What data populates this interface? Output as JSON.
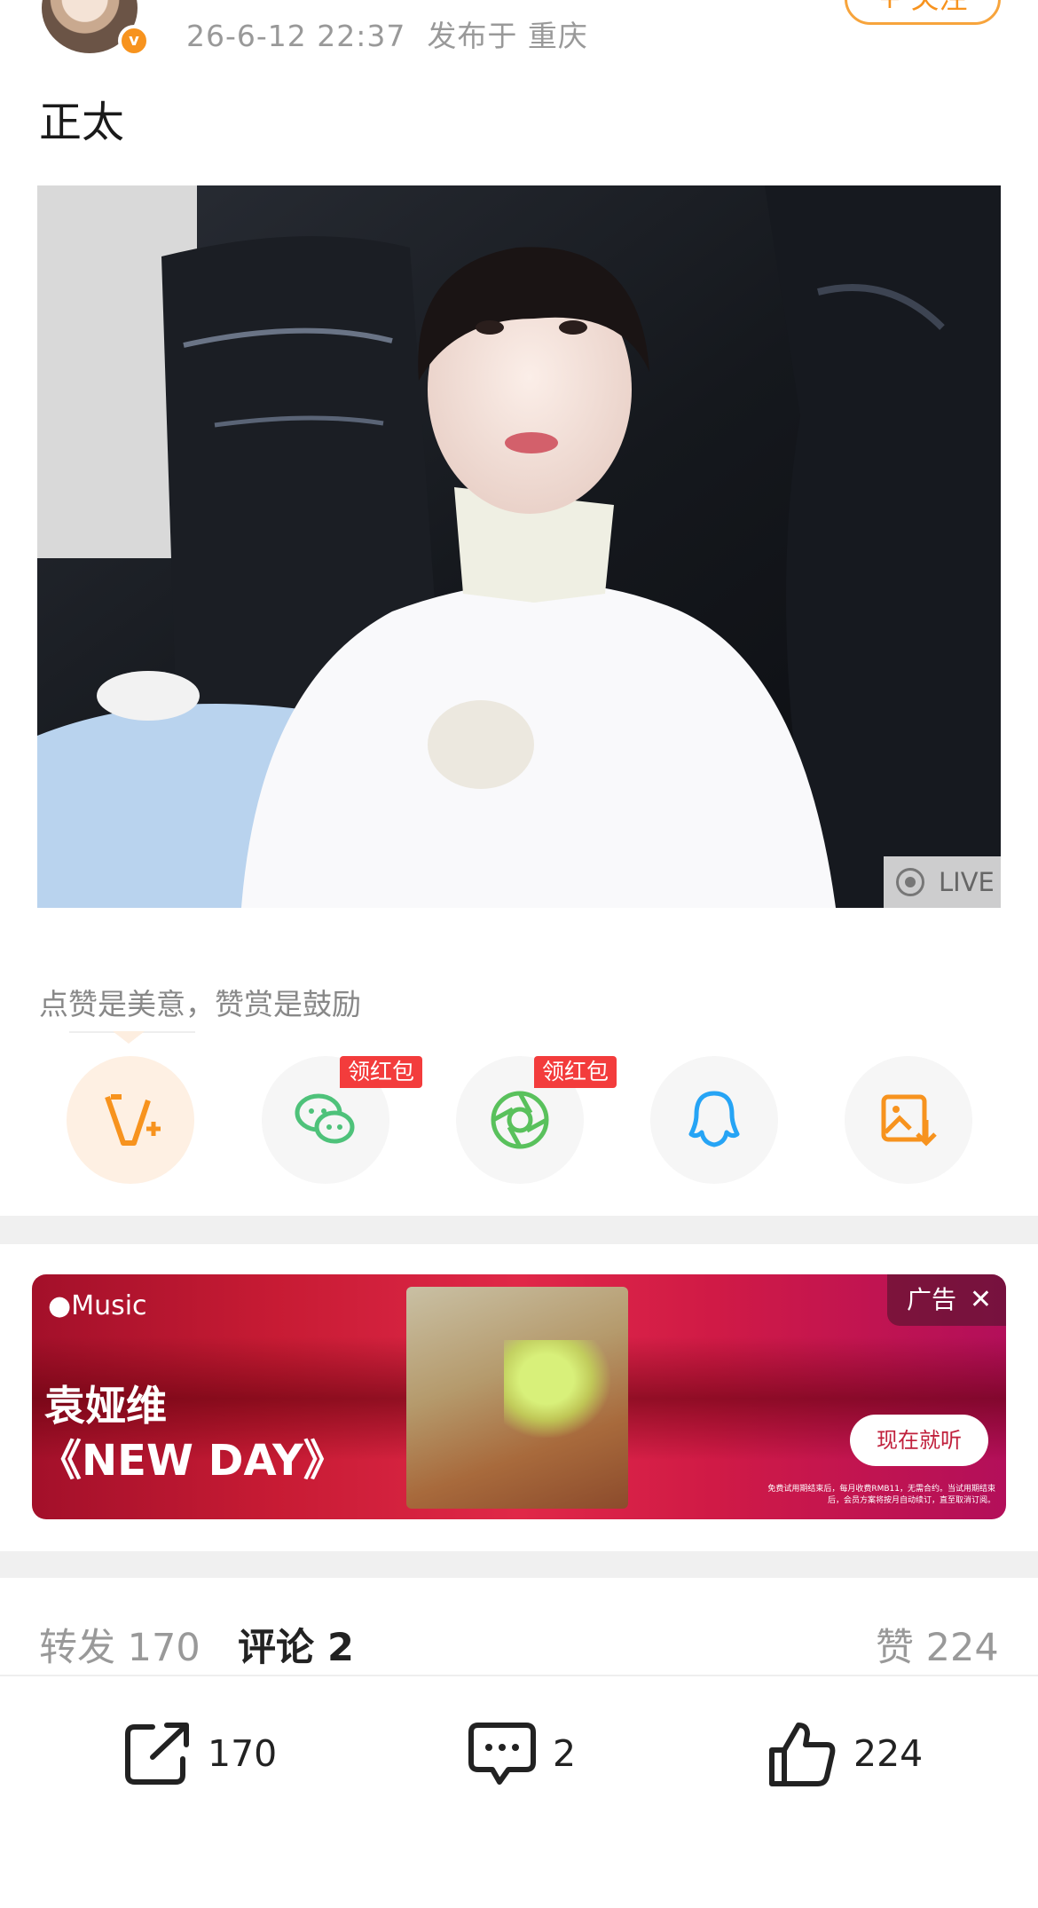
{
  "header": {
    "timestamp": "26-6-12 22:37",
    "location": "发布于 重庆",
    "follow_label": "+ 关注",
    "verified_mark": "v"
  },
  "post": {
    "text": "正太",
    "live_label": "LIVE"
  },
  "reward": {
    "text": "点赞是美意，赞赏是鼓励"
  },
  "share": {
    "items": [
      {
        "icon": "vplus-icon",
        "color": "#f7931e"
      },
      {
        "icon": "wechat-icon",
        "color": "#4ec27a",
        "tag": "领红包"
      },
      {
        "icon": "moments-icon",
        "color": "#59c15c",
        "tag": "领红包"
      },
      {
        "icon": "qq-icon",
        "color": "#26a4f5"
      },
      {
        "icon": "save-image-icon",
        "color": "#f7931e"
      }
    ]
  },
  "ad": {
    "brand": "Music",
    "artist": "袁娅维",
    "album": "《NEW DAY》",
    "tag": "广告",
    "cta": "现在就听",
    "fine_print": "免费试用期结束后，每月收费RMB11，无需合约。当试用期结束后，会员方案将按月自动续订，直至取消订阅。"
  },
  "stats": {
    "repost_label": "转发 170",
    "comment_label": "评论 2",
    "like_label": "赞 224"
  },
  "actions": {
    "repost_count": "170",
    "comment_count": "2",
    "like_count": "224"
  },
  "colors": {
    "accent": "#f7931e",
    "ad_red": "#d01a3a"
  }
}
